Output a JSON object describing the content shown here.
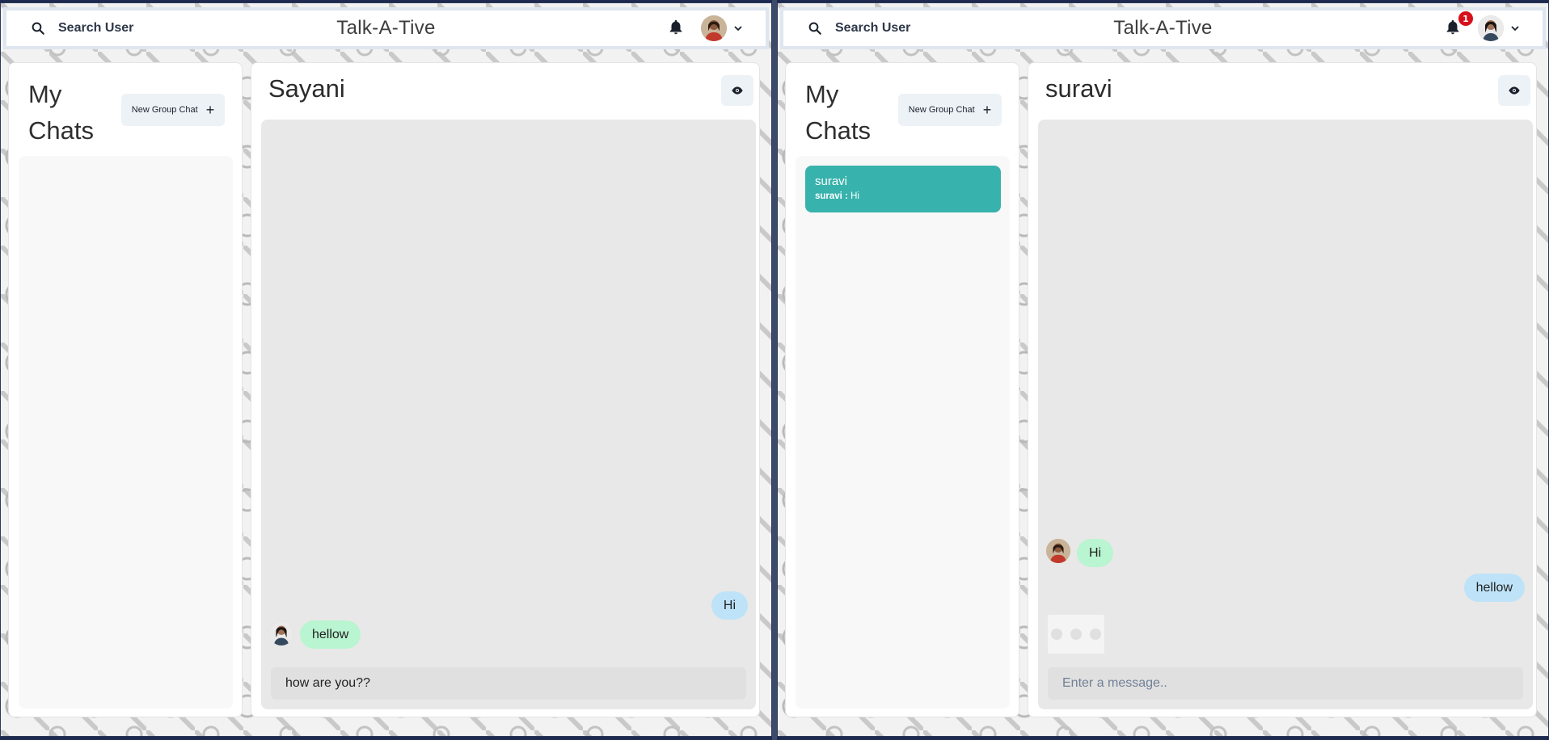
{
  "left": {
    "topbar": {
      "search_label": "Search User",
      "app_title": "Talk-A-Tive",
      "notification_count": ""
    },
    "chats": {
      "heading": "My Chats",
      "new_group_label": "New Group Chat",
      "items": []
    },
    "chat": {
      "title": "Sayani",
      "messages": [
        {
          "side": "sent",
          "text": "Hi"
        },
        {
          "side": "received",
          "text": "hellow"
        }
      ],
      "input_value": "how are you??",
      "input_placeholder": "Enter a message.."
    }
  },
  "right": {
    "topbar": {
      "search_label": "Search User",
      "app_title": "Talk-A-Tive",
      "notification_count": "1"
    },
    "chats": {
      "heading": "My Chats",
      "new_group_label": "New Group Chat",
      "items": [
        {
          "name": "suravi",
          "latest_sender": "suravi :",
          "latest_text": "Hi",
          "selected": true
        }
      ]
    },
    "chat": {
      "title": "suravi",
      "messages": [
        {
          "side": "received",
          "text": "Hi"
        },
        {
          "side": "sent",
          "text": "hellow"
        }
      ],
      "typing_indicator": true,
      "input_value": "",
      "input_placeholder": "Enter a message.."
    }
  },
  "icons": {
    "search": "search-icon",
    "bell": "bell-icon",
    "chevron": "chevron-down-icon",
    "plus": "plus-icon",
    "eye": "eye-icon"
  },
  "colors": {
    "accent_teal": "#38b2ac",
    "sent_bubble": "#bee3f8",
    "received_bubble": "#b9f5d0",
    "badge_red": "#d8101b"
  }
}
